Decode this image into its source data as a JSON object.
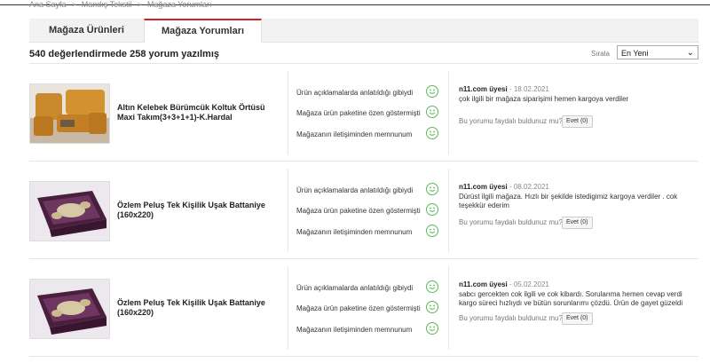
{
  "breadcrumb": [
    "Ana Sayfa",
    "Mandış Tekstil",
    "Mağaza Yorumları"
  ],
  "tabs": [
    {
      "label": "Mağaza Ürünleri"
    },
    {
      "label": "Mağaza Yorumları"
    }
  ],
  "summary": "540 değerlendirmede 258 yorum yazılmış",
  "sort": {
    "label": "Sırala",
    "selected": "En Yeni"
  },
  "criteria": [
    "Ürün açıklamalarda anlatıldığı gibiydi",
    "Mağaza ürün paketine özen göstermişti",
    "Mağazanın iletişiminden memnunum"
  ],
  "helpful_prompt": "Bu yorumu faydalı buldunuz mu?",
  "reviews": [
    {
      "product": "Altın Kelebek Bürümcük Koltuk Örtüsü Maxi Takım(3+3+1+1)-K.Hardal",
      "user": "n11.com üyesi",
      "date": "18.02.2021",
      "comment": "çok ilgili bir mağaza siparişimi hemen kargoya verdiler",
      "vote": "Evet (0)"
    },
    {
      "product": "Özlem Peluş Tek Kişilik Uşak Battaniye (160x220)",
      "user": "n11.com üyesi",
      "date": "08.02.2021",
      "comment": "Dürüst ilgili mağaza. Hızlı bir şekilde istedigimiz kargoya verdiler . cok teşekkür ederim",
      "vote": "Evet (0)"
    },
    {
      "product": "Özlem Peluş Tek Kişilik Uşak Battaniye (160x220)",
      "user": "n11.com üyesi",
      "date": "05.02.2021",
      "comment": "sabcı gercekten cok ilgili ve cok kibardı. Sorularıma hemen cevap verdi kargo süreci hızlıydı ve bütün sorunlarımı çözdü. Ürün de gayet güzeldi",
      "vote": "Evet (0)"
    }
  ],
  "colors": {
    "accent": "#d81f26",
    "smiley": "#5cb85c"
  }
}
